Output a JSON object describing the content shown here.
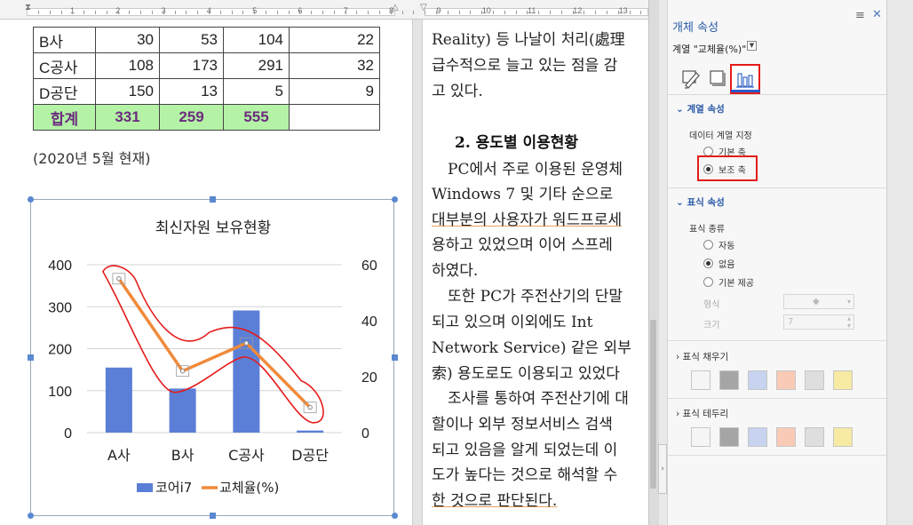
{
  "ruler": {
    "numbers": [
      "1",
      "2",
      "3",
      "4",
      "5",
      "6",
      "7",
      "8",
      "9",
      "10",
      "11",
      "12",
      "13",
      "14"
    ]
  },
  "table": {
    "rows": [
      {
        "label": "B사",
        "v1": "30",
        "v2": "53",
        "v3": "104",
        "v4": "22"
      },
      {
        "label": "C공사",
        "v1": "108",
        "v2": "173",
        "v3": "291",
        "v4": "32"
      },
      {
        "label": "D공단",
        "v1": "150",
        "v2": "13",
        "v3": "5",
        "v4": "9"
      }
    ],
    "total": {
      "label": "합계",
      "v1": "331",
      "v2": "259",
      "v3": "555",
      "v4": ""
    },
    "note": "(2020년 5월 현재)"
  },
  "chart_data": {
    "type": "bar",
    "title": "최신자원 보유현황",
    "categories": [
      "A사",
      "B사",
      "C공사",
      "D공단"
    ],
    "series": [
      {
        "name": "코어i7",
        "type": "bar",
        "axis": "primary",
        "color": "#5b7fd6",
        "values": [
          155,
          105,
          291,
          5
        ]
      },
      {
        "name": "교체율(%)",
        "type": "line",
        "axis": "secondary",
        "color": "#f08a3a",
        "values": [
          55,
          22,
          32,
          9
        ]
      }
    ],
    "y_primary": {
      "min": 0,
      "max": 400,
      "ticks": [
        "0",
        "100",
        "200",
        "300",
        "400"
      ]
    },
    "y_secondary": {
      "min": 0,
      "max": 60,
      "ticks": [
        "0",
        "20",
        "40",
        "60"
      ]
    },
    "grid": true,
    "legend_position": "bottom"
  },
  "document": {
    "lines": [
      "Reality) 등 나날이 처리(處理",
      "급수적으로 늘고 있는 점을 감",
      "고 있다."
    ],
    "heading": "2. 용도별 이용현황",
    "lines2": [
      "PC에서 주로 이용된 운영체",
      "Windows 7 및 기타 순으로",
      "대부분의 사용자가 워드프로세",
      "용하고 있었으며 이어 스프레",
      "하였다.",
      "또한 PC가 주전산기의 단말",
      "되고 있으며 이외에도 Int",
      "Network Service) 같은 외부",
      "索) 용도로도 이용되고 있었다",
      "조사를 통하여 주전산기에 대",
      "할이나 외부 정보서비스 검색",
      "되고 있음을 알게 되었는데 이",
      "도가 높다는 것으로 해석할 수",
      "한 것으로 판단된다."
    ]
  },
  "panel": {
    "title": "개체 속성",
    "series_selector": "계열 \"교체율(%)\"",
    "section_series": "계열 속성",
    "data_series_label": "데이터 계열 지정",
    "axis_options": [
      {
        "label": "기본 축",
        "selected": false
      },
      {
        "label": "보조 축",
        "selected": true
      }
    ],
    "section_marker": "표식 속성",
    "marker_type_label": "표식 종류",
    "marker_options": [
      {
        "label": "자동",
        "selected": false
      },
      {
        "label": "없음",
        "selected": true
      },
      {
        "label": "기본 제공",
        "selected": false
      }
    ],
    "shape_label": "형식",
    "size_label": "크기",
    "size_value": "7",
    "section_fill": "표식 채우기",
    "section_border": "표식 테두리",
    "swatches": [
      "#f5f5f5",
      "#a5a5a5",
      "#c7d3ef",
      "#f9cbb6",
      "#dedede",
      "#f7eaa3"
    ]
  }
}
